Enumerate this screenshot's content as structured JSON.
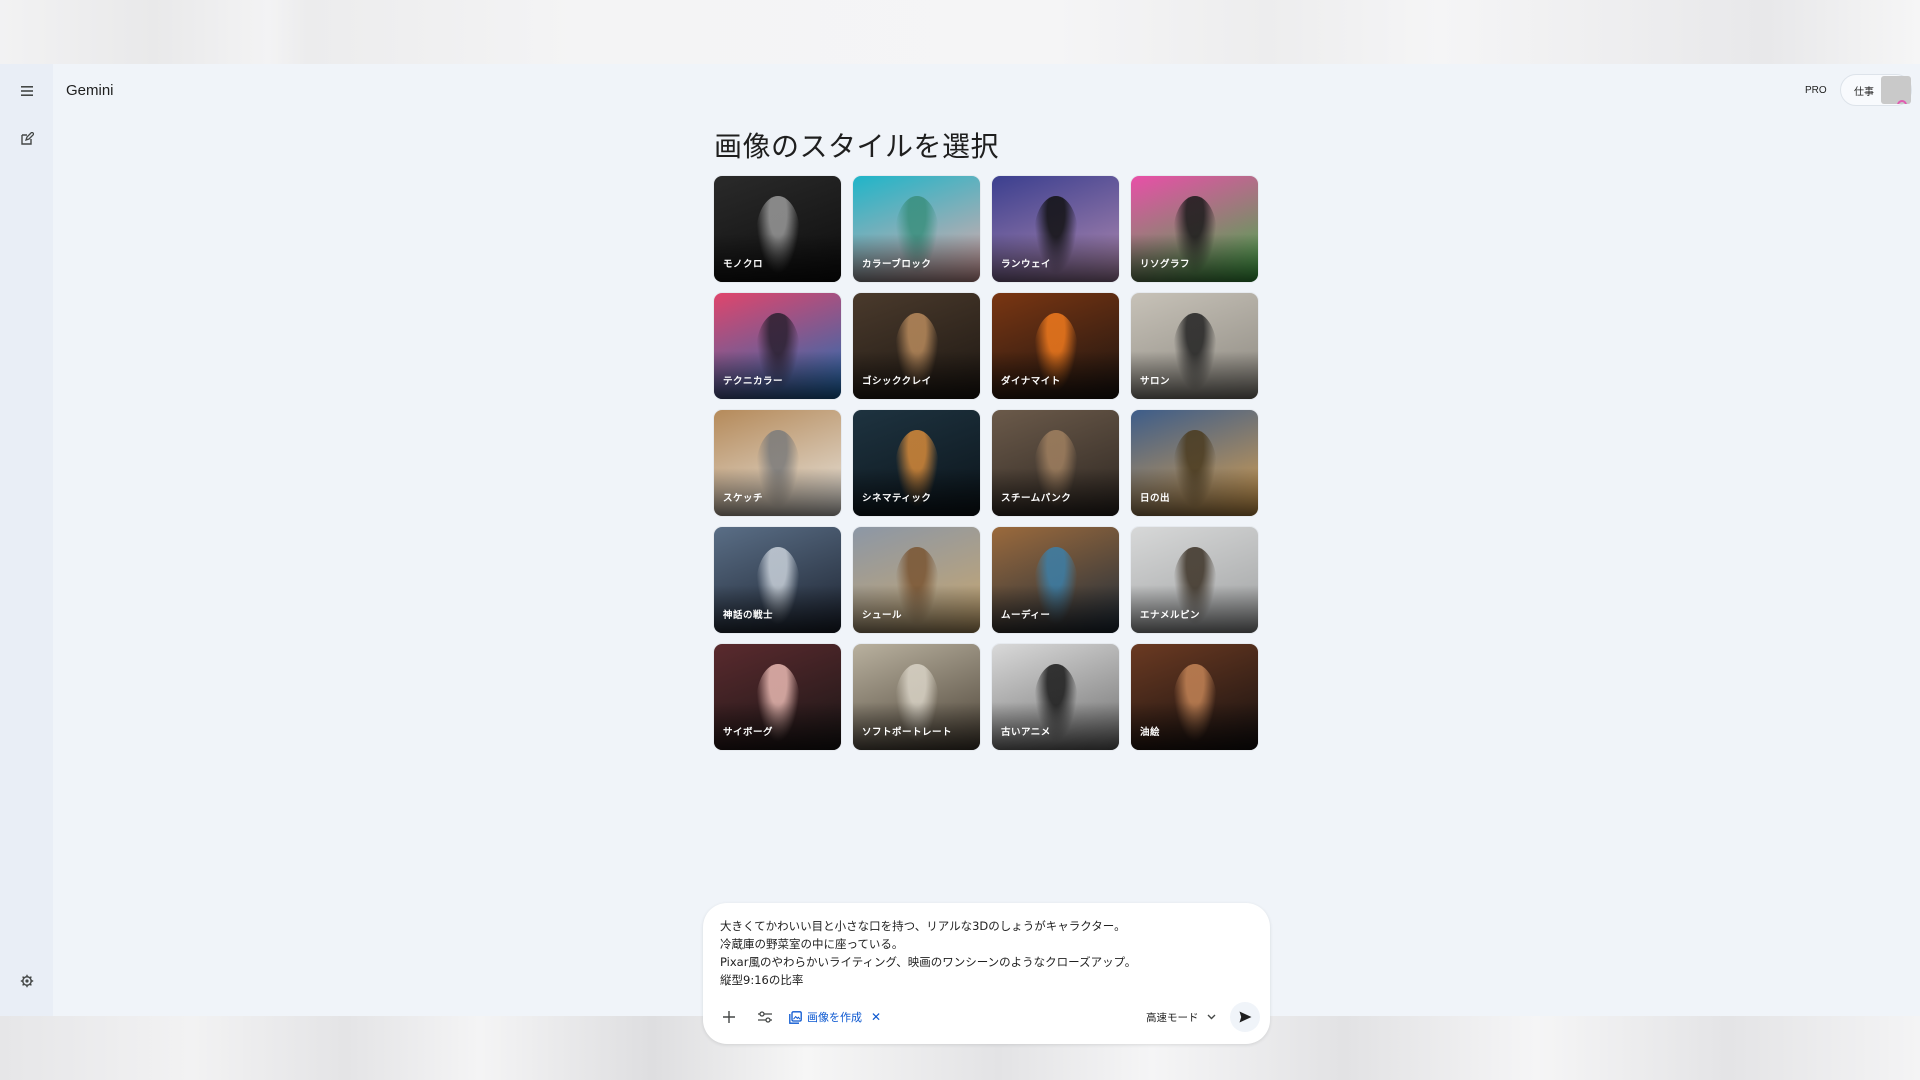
{
  "app": {
    "brand": "Gemini",
    "pro_badge": "PRO",
    "account_label": "仕事"
  },
  "rail": {
    "menu_icon": "menu-icon",
    "new_chat_icon": "edit-icon",
    "settings_icon": "gear-icon"
  },
  "gallery": {
    "title": "画像のスタイルを選択",
    "styles": [
      {
        "label": "モノクロ",
        "colors": [
          "#2a2a2a",
          "#0d0d0d"
        ],
        "accent": "#9a9a9a"
      },
      {
        "label": "カラーブロック",
        "colors": [
          "#1fb5c9",
          "#e8a9a9"
        ],
        "accent": "#3a8f7d"
      },
      {
        "label": "ランウェイ",
        "colors": [
          "#3b3f8f",
          "#b28ab0"
        ],
        "accent": "#111111"
      },
      {
        "label": "リソグラフ",
        "colors": [
          "#e94fa8",
          "#3fae46"
        ],
        "accent": "#1a1a1a"
      },
      {
        "label": "テクニカラー",
        "colors": [
          "#e0456c",
          "#1b6fb5"
        ],
        "accent": "#2a2030"
      },
      {
        "label": "ゴシッククレイ",
        "colors": [
          "#4a3a2c",
          "#1d1712"
        ],
        "accent": "#b88a5c"
      },
      {
        "label": "ダイナマイト",
        "colors": [
          "#7a3612",
          "#1b1411"
        ],
        "accent": "#f07a1e"
      },
      {
        "label": "サロン",
        "colors": [
          "#c7c2b8",
          "#8c8880"
        ],
        "accent": "#222222"
      },
      {
        "label": "スケッチ",
        "colors": [
          "#b58a5a",
          "#e9e6e0"
        ],
        "accent": "#7b7b7b"
      },
      {
        "label": "シネマティック",
        "colors": [
          "#1e3340",
          "#0b141a"
        ],
        "accent": "#d68a3a"
      },
      {
        "label": "スチームパンク",
        "colors": [
          "#6b5a4a",
          "#2d2621"
        ],
        "accent": "#a08060"
      },
      {
        "label": "日の出",
        "colors": [
          "#3d5d8a",
          "#d9a04e"
        ],
        "accent": "#4b3b1f"
      },
      {
        "label": "神話の戦士",
        "colors": [
          "#5a6e86",
          "#1c2330"
        ],
        "accent": "#c9d1da"
      },
      {
        "label": "シュール",
        "colors": [
          "#8c97a6",
          "#c9a76e"
        ],
        "accent": "#7a5532"
      },
      {
        "label": "ムーディー",
        "colors": [
          "#9b6a3c",
          "#1e2c3a"
        ],
        "accent": "#3c7fa8"
      },
      {
        "label": "エナメルピン",
        "colors": [
          "#d7d8d8",
          "#9fa1a2"
        ],
        "accent": "#3c3226"
      },
      {
        "label": "サイボーグ",
        "colors": [
          "#5a2a2e",
          "#1a1616"
        ],
        "accent": "#e9b9b2"
      },
      {
        "label": "ソフトポートレート",
        "colors": [
          "#b9b19f",
          "#4b4236"
        ],
        "accent": "#d9d3c6"
      },
      {
        "label": "古いアニメ",
        "colors": [
          "#d9d9d9",
          "#6f6f6f"
        ],
        "accent": "#1a1a1a"
      },
      {
        "label": "油絵",
        "colors": [
          "#6b3a22",
          "#151010"
        ],
        "accent": "#c48456"
      }
    ]
  },
  "composer": {
    "prompt_lines": [
      "大きくてかわいい目と小さな口を持つ、リアルな3Dのしょうがキャラクター。",
      "冷蔵庫の野菜室の中に座っている。",
      "Pixar風のやわらかいライティング、映画のワンシーンのようなクローズアップ。",
      "縦型9:16の比率"
    ],
    "chip_label": "画像を作成",
    "mode_label": "高速モード"
  }
}
